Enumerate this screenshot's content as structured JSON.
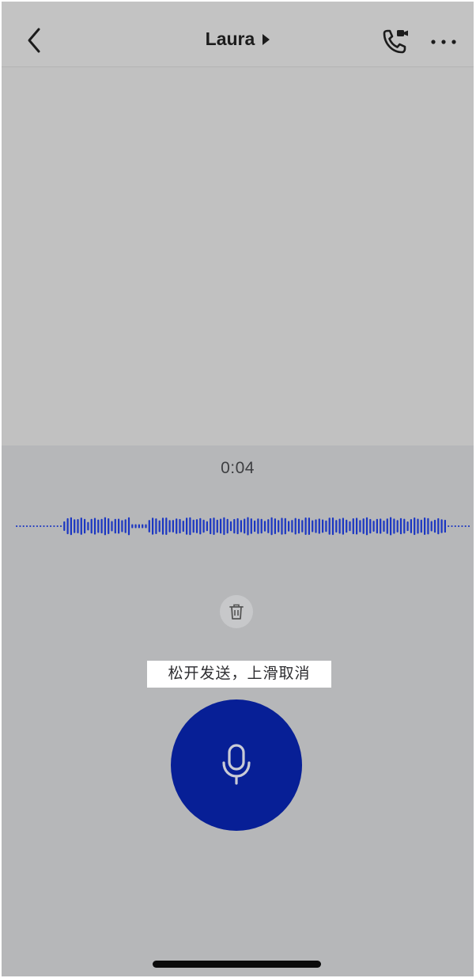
{
  "header": {
    "title": "Laura",
    "back_icon": "chevron-left-icon",
    "title_caret_icon": "caret-right-icon",
    "call_icon": "phone-video-call-icon",
    "more_icon": "more-horizontal-icon"
  },
  "voice_recorder": {
    "timer": "0:04",
    "delete_icon": "trash-icon",
    "hint": "松开发送，上滑取消",
    "mic_icon": "microphone-icon",
    "colors": {
      "accent": "#071f96",
      "waveform": "#1b36c2",
      "panel_bg": "#b6b7b9",
      "chat_bg": "#c1c1c1"
    }
  }
}
